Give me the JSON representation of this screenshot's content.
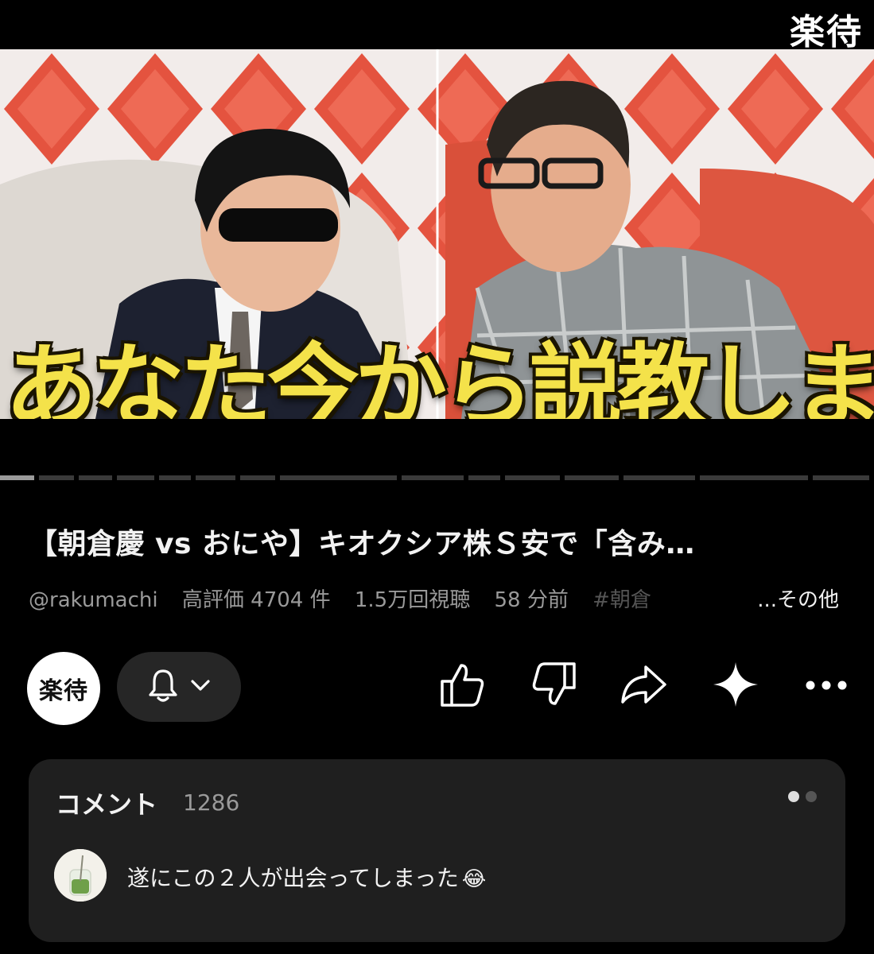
{
  "player": {
    "channel_watermark": "楽待",
    "thumbnail_caption": "あなた今から説教します",
    "progress_fraction": 0.04
  },
  "video": {
    "title": "【朝倉慶 vs おにや】キオクシア株Ｓ安で「含み…",
    "channel_handle": "@rakumachi",
    "likes": "高評価 4704 件",
    "views": "1.5万回視聴",
    "age": "58 分前",
    "hashtag": "#朝倉",
    "more_label": "...その他"
  },
  "actions": {
    "channel_avatar_text": "楽待",
    "icons": [
      "bell-icon",
      "chevron-down-icon",
      "like-icon",
      "dislike-icon",
      "share-icon",
      "sparkle-icon",
      "more-icon"
    ]
  },
  "comments": {
    "heading": "コメント",
    "count": "1286",
    "top_comment": "遂にこの２人が出会ってしまった",
    "top_comment_emoji": "😂"
  },
  "colors": {
    "background": "#000000",
    "caption_yellow": "#f4e24a",
    "card": "#1f1f1f",
    "muted_text": "#9a9a9a"
  }
}
